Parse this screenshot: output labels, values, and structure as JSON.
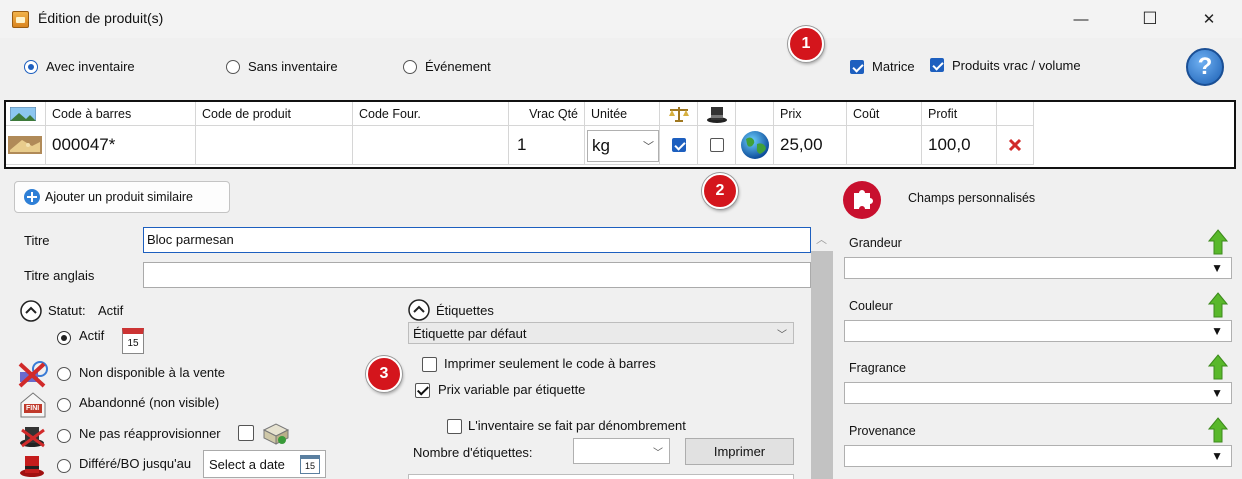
{
  "window": {
    "title": "Édition de produit(s)",
    "minimize": "—",
    "maximize": "☐",
    "close": "✕"
  },
  "top": {
    "radio_inventory": "Avec inventaire",
    "radio_no_inventory": "Sans inventaire",
    "radio_event": "Événement",
    "check_matrix": "Matrice",
    "check_bulk": "Produits vrac / volume",
    "help": "?"
  },
  "badges": {
    "b1": "1",
    "b2": "2",
    "b3": "3"
  },
  "grid": {
    "headers": {
      "barcode": "Code à barres",
      "product_code": "Code de produit",
      "supplier_code": "Code Four.",
      "bulk_qty": "Vrac Qté",
      "unit": "Unitée",
      "price": "Prix",
      "cost": "Coût",
      "profit": "Profit"
    },
    "row": {
      "barcode": "000047*",
      "product_code": "",
      "supplier_code": "",
      "bulk_qty": "1",
      "unit": "kg",
      "price": "25,00",
      "cost": "",
      "profit": "100,0"
    }
  },
  "left": {
    "add_similar": "Ajouter un produit similaire",
    "title_label": "Titre",
    "title_value": "Bloc parmesan",
    "title_en_label": "Titre anglais",
    "title_en_value": "",
    "status_label": "Statut:",
    "status_value": "Actif",
    "status_active": "Actif",
    "status_unavailable": "Non disponible à la vente",
    "status_abandoned": "Abandonné (non visible)",
    "status_no_restock": "Ne pas réapprovisionner",
    "status_deferred": "Différé/BO jusqu'au",
    "date_placeholder": "Select a date",
    "calendar_day": "15",
    "fini": "FINI"
  },
  "labels": {
    "section": "Étiquettes",
    "default_label": "Étiquette par défaut",
    "print_barcode_only": "Imprimer seulement le code à barres",
    "variable_price": "Prix variable par étiquette",
    "count_inventory": "L'inventaire se fait par dénombrement",
    "label_count": "Nombre d'étiquettes:",
    "print_button": "Imprimer"
  },
  "custom_fields": {
    "title": "Champs personnalisés",
    "fields": [
      "Grandeur",
      "Couleur",
      "Fragrance",
      "Provenance"
    ]
  },
  "colors": {
    "accent": "#1d5fbf",
    "badge": "#d4151c",
    "delete": "#d12a2a",
    "up_arrow": "#59b82b"
  }
}
